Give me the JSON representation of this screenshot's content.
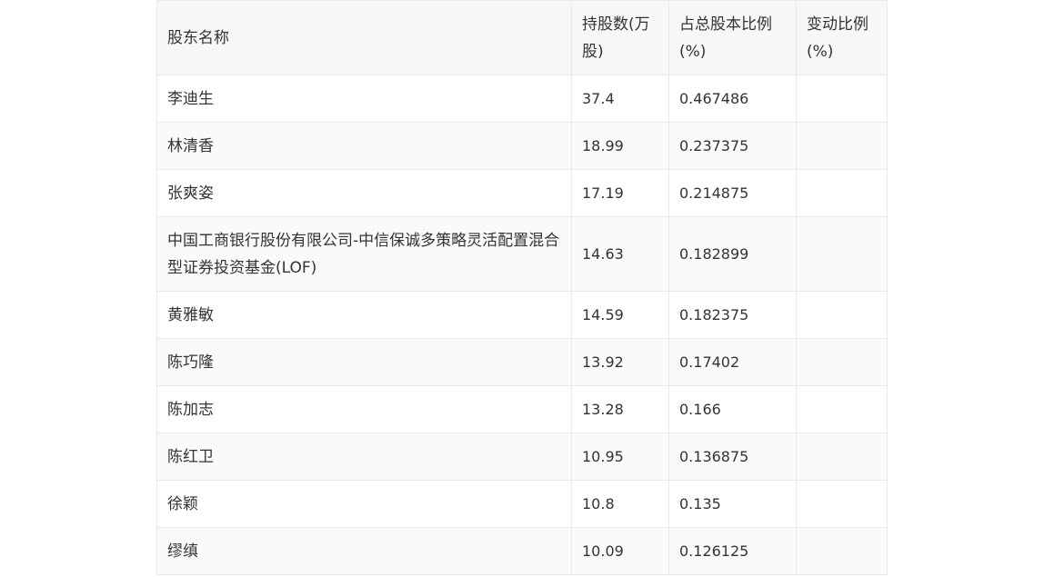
{
  "table": {
    "headers": [
      "股东名称",
      "持股数(万股)",
      "占总股本比例(%)",
      "变动比例(%)"
    ],
    "rows": [
      {
        "name": "李迪生",
        "shares": "37.4",
        "ratio": "0.467486",
        "change": ""
      },
      {
        "name": "林清香",
        "shares": "18.99",
        "ratio": "0.237375",
        "change": ""
      },
      {
        "name": "张爽姿",
        "shares": "17.19",
        "ratio": "0.214875",
        "change": ""
      },
      {
        "name": "中国工商银行股份有限公司-中信保诚多策略灵活配置混合型证券投资基金(LOF)",
        "shares": "14.63",
        "ratio": "0.182899",
        "change": ""
      },
      {
        "name": "黄雅敏",
        "shares": "14.59",
        "ratio": "0.182375",
        "change": ""
      },
      {
        "name": "陈巧隆",
        "shares": "13.92",
        "ratio": "0.17402",
        "change": ""
      },
      {
        "name": "陈加志",
        "shares": "13.28",
        "ratio": "0.166",
        "change": ""
      },
      {
        "name": "陈红卫",
        "shares": "10.95",
        "ratio": "0.136875",
        "change": ""
      },
      {
        "name": "徐颖",
        "shares": "10.8",
        "ratio": "0.135",
        "change": ""
      },
      {
        "name": "缪缜",
        "shares": "10.09",
        "ratio": "0.126125",
        "change": ""
      }
    ]
  }
}
